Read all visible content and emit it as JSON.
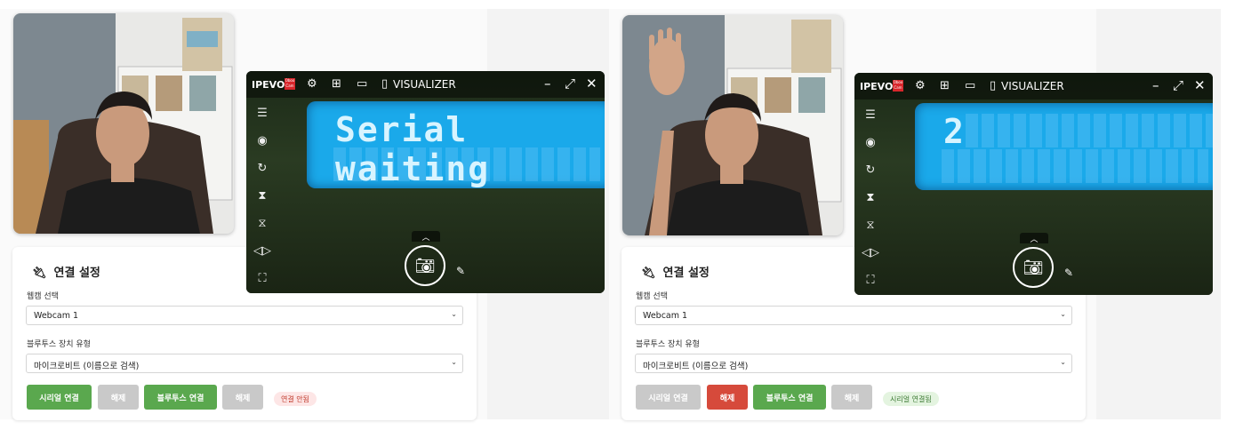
{
  "panels": [
    {
      "card_title": "연결 설정",
      "webcam_label": "웹캠 선택",
      "webcam_value": "Webcam 1",
      "bt_label": "블루투스 장치 유형",
      "bt_value": "마이크로비트 (이름으로 검색)",
      "buttons": [
        "시리얼 연결",
        "해제",
        "블루투스 연결",
        "해제"
      ],
      "status": "연결 안됨",
      "lcd_text": "Serial waiting"
    },
    {
      "card_title": "연결 설정",
      "webcam_label": "웹캠 선택",
      "webcam_value": "Webcam 1",
      "bt_label": "블루투스 장치 유형",
      "bt_value": "마이크로비트 (이름으로 검색)",
      "buttons": [
        "시리얼 연결",
        "해제",
        "블루투스 연결",
        "해제"
      ],
      "status": "시리얼 연결됨",
      "lcd_text": "2"
    }
  ],
  "visualizer": {
    "brand": "IPEVO",
    "logo": "Oboo Cam",
    "title": "VISUALIZER"
  },
  "icons": {
    "pin": "plug-icon",
    "chevron": "chevron-down-icon",
    "camera": "camera-icon"
  },
  "colors": {
    "green": "#5aa84e",
    "red": "#d64a3b",
    "gray": "#c9c9c9",
    "lcd": "#1aa9ea"
  }
}
